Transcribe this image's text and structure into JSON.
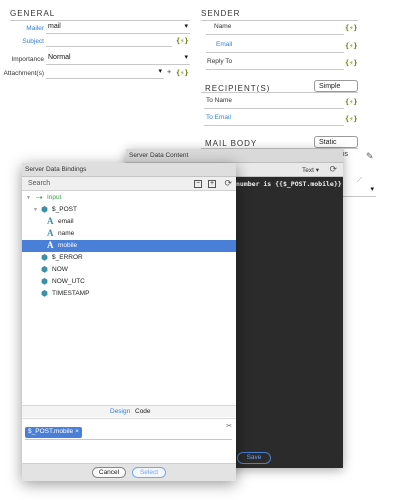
{
  "general": {
    "title": "GENERAL",
    "mailer_label": "Mailer",
    "mailer_value": "mail",
    "subject_label": "Subject",
    "importance_label": "Importance",
    "importance_value": "Normal",
    "attachments_label": "Attachment(s)"
  },
  "sender": {
    "title": "SENDER",
    "name_label": "Name",
    "email_label": "Email",
    "replyto_label": "Reply To"
  },
  "recipient": {
    "title": "RECIPIENT(S)",
    "mode_button": "Simple",
    "toname_label": "To Name",
    "toemail_label": "To Email"
  },
  "mailbody": {
    "title": "MAIL BODY",
    "mode_button": "Static",
    "partial_text": "is"
  },
  "glyphs": {
    "bolt": "{⚡}",
    "dropdown": "▾",
    "plus": "+"
  },
  "content_dialog": {
    "title": "Server Data Content",
    "mode": "Text ▾",
    "code_text": "number is {{$_POST.mobile}}",
    "save_label": "Save"
  },
  "bindings_dialog": {
    "title": "Server Data Bindings",
    "search_placeholder": "Search",
    "tree": [
      {
        "label": "Input",
        "icon": "input-icon"
      },
      {
        "label": "$_POST",
        "icon": "cube-icon"
      },
      {
        "label": "email",
        "icon": "text-icon"
      },
      {
        "label": "name",
        "icon": "text-icon"
      },
      {
        "label": "mobile",
        "icon": "text-icon",
        "selected": true
      },
      {
        "label": "$_ERROR",
        "icon": "cube-icon"
      },
      {
        "label": "NOW",
        "icon": "cube-icon"
      },
      {
        "label": "NOW_UTC",
        "icon": "cube-icon"
      },
      {
        "label": "TIMESTAMP",
        "icon": "cube-icon"
      }
    ],
    "tab_design": "Design",
    "tab_code": "Code",
    "chip_label": "$_POST.mobile",
    "chip_close": "×",
    "cancel_label": "Cancel",
    "select_label": "Select"
  },
  "colors": {
    "accent": "#2f7fe0",
    "selection": "#4a7fd8",
    "code_bg": "#2b2b2b"
  }
}
